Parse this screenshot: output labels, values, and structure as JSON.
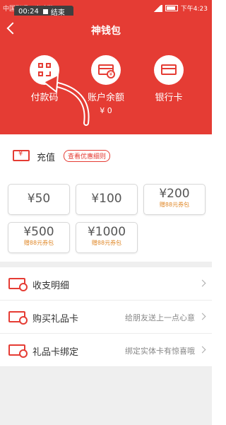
{
  "status_bar": {
    "carrier": "中国联通 | 米哈游",
    "recording_time": "00:24",
    "recording_action": "结束",
    "time": "下午4:23"
  },
  "header": {
    "title": "神钱包",
    "features": [
      {
        "label": "付款码",
        "sub": ""
      },
      {
        "label": "账户余额",
        "sub": "¥ 0"
      },
      {
        "label": "银行卡",
        "sub": ""
      }
    ]
  },
  "recharge": {
    "label": "充值",
    "promo_link": "查看优惠细则",
    "amounts": [
      {
        "value": "¥50",
        "bonus": ""
      },
      {
        "value": "¥100",
        "bonus": ""
      },
      {
        "value": "¥200",
        "bonus": "赠88元券包"
      },
      {
        "value": "¥500",
        "bonus": "赠88元券包"
      },
      {
        "value": "¥1000",
        "bonus": "赠88元券包"
      }
    ]
  },
  "menu": [
    {
      "label": "收支明细",
      "hint": ""
    },
    {
      "label": "购买礼品卡",
      "hint": "给朋友送上一点心意"
    },
    {
      "label": "礼品卡绑定",
      "hint": "绑定实体卡有惊喜哦"
    }
  ],
  "colors": {
    "brand_red": "#e53c34",
    "bonus_orange": "#e0892a"
  }
}
